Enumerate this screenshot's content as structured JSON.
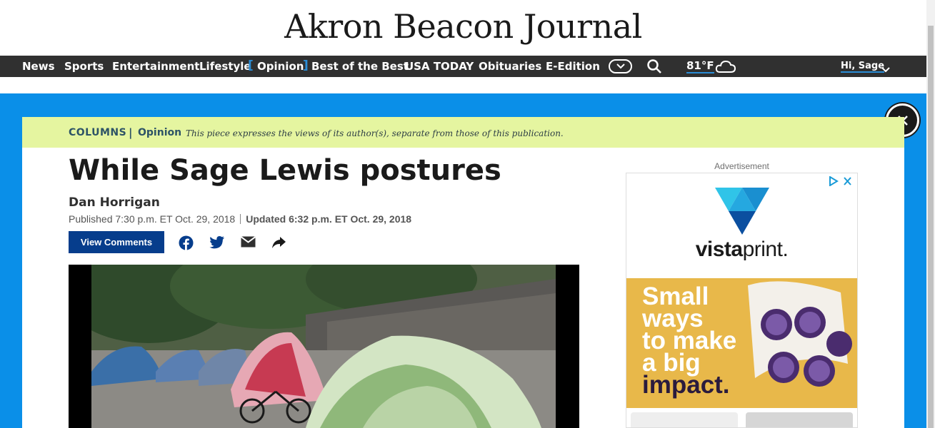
{
  "masthead": {
    "title": "Akron Beacon Journal"
  },
  "nav": {
    "items": [
      "News",
      "Sports",
      "Entertainment",
      "Lifestyle",
      "Opinion",
      "Best of the Best",
      "USA TODAY",
      "Obituaries",
      "E-Edition"
    ],
    "weather": "81°F",
    "user": "Hi, Sage"
  },
  "opinion_bar": {
    "section": "COLUMNS",
    "separator": "|",
    "label": "Opinion",
    "disclaimer": "This piece expresses the views of its author(s), separate from those of this publication."
  },
  "article": {
    "headline": "While Sage Lewis postures",
    "author": "Dan Horrigan",
    "published": "Published 7:30 p.m. ET Oct. 29, 2018",
    "updated": "Updated 6:32 p.m. ET Oct. 29, 2018",
    "comments_button": "View Comments"
  },
  "ad": {
    "label": "Advertisement",
    "brand_prefix": "vista",
    "brand_suffix": "print.",
    "promo_line1": "Small",
    "promo_line2": "ways",
    "promo_line3": "to make",
    "promo_line4": "a big",
    "promo_line5": "impact."
  },
  "colors": {
    "nav_bg": "#303030",
    "overlay_blue": "#0a8fe8",
    "opinion_bar": "#e5f5a0",
    "button_blue": "#063d8c",
    "ad_yellow": "#e8b84a"
  }
}
